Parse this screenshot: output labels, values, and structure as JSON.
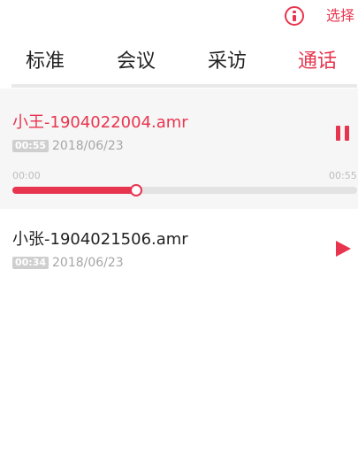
{
  "header": {
    "info_icon": "info-circle-icon",
    "select_label": "选择"
  },
  "tabs": [
    {
      "label": "标准",
      "active": false
    },
    {
      "label": "会议",
      "active": false
    },
    {
      "label": "采访",
      "active": false
    },
    {
      "label": "通话",
      "active": true
    }
  ],
  "recordings": [
    {
      "name": "小王-1904022004.amr",
      "duration": "00:55",
      "date": "2018/06/23",
      "state": "playing",
      "control_icon": "pause-icon",
      "elapsed": "00:00",
      "total": "00:55",
      "progress": 0.36
    },
    {
      "name": "小张-1904021506.amr",
      "duration": "00:34",
      "date": "2018/06/23",
      "state": "stopped",
      "control_icon": "play-icon"
    }
  ],
  "colors": {
    "accent": "#e8354f",
    "track": "#e3e3e3",
    "active_card_bg": "#f6f6f6"
  }
}
